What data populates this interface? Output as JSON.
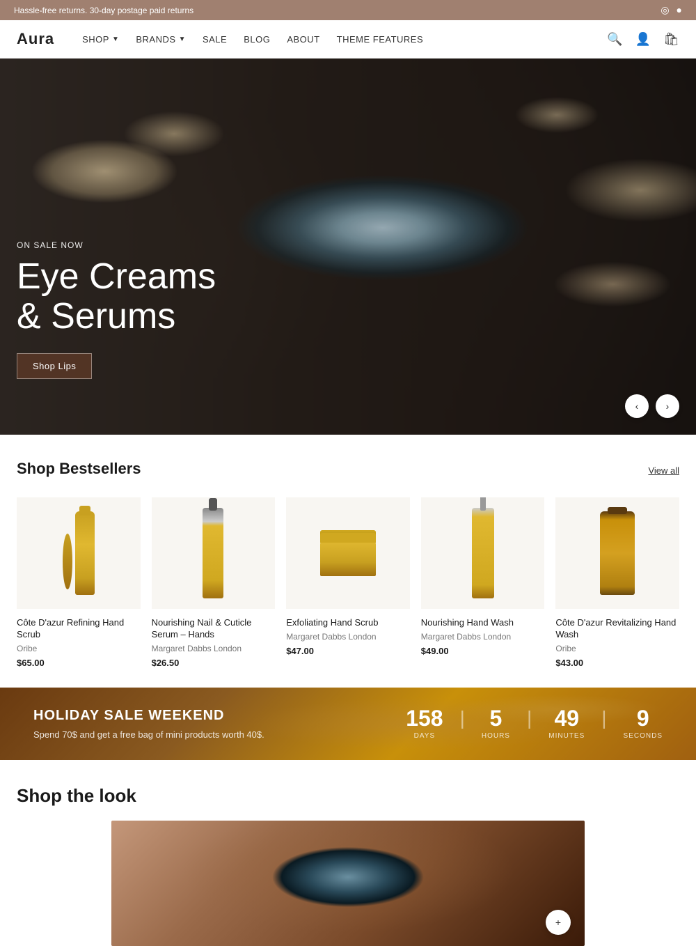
{
  "announcement": {
    "text": "Hassle-free returns. 30-day postage paid returns",
    "social": {
      "instagram": "instagram-icon",
      "facebook": "facebook-icon"
    }
  },
  "header": {
    "logo": "Aura",
    "nav": [
      {
        "label": "SHOP",
        "hasDropdown": true
      },
      {
        "label": "BRANDS",
        "hasDropdown": true
      },
      {
        "label": "SALE",
        "hasDropdown": false
      },
      {
        "label": "BLOG",
        "hasDropdown": false
      },
      {
        "label": "ABOUT",
        "hasDropdown": false
      },
      {
        "label": "THEME FEATURES",
        "hasDropdown": false
      }
    ],
    "icons": {
      "search": "search-icon",
      "account": "account-icon",
      "cart": "cart-icon"
    }
  },
  "hero": {
    "tag": "ON SALE NOW",
    "title_line1": "Eye Creams",
    "title_line2": "& Serums",
    "cta_label": "Shop Lips"
  },
  "bestsellers": {
    "title": "Shop Bestsellers",
    "view_all": "View all",
    "products": [
      {
        "name": "Côte D'azur Refining Hand Scrub",
        "brand": "Oribe",
        "price": "$65.00",
        "type": "tube"
      },
      {
        "name": "Nourishing Nail & Cuticle Serum – Hands",
        "brand": "Margaret Dabbs London",
        "price": "$26.50",
        "type": "bottle"
      },
      {
        "name": "Exfoliating Hand Scrub",
        "brand": "Margaret Dabbs London",
        "price": "$47.00",
        "type": "jar"
      },
      {
        "name": "Nourishing Hand Wash",
        "brand": "Margaret Dabbs London",
        "price": "$49.00",
        "type": "pump"
      },
      {
        "name": "Côte D'azur Revitalizing Hand Wash",
        "brand": "Oribe",
        "price": "$43.00",
        "type": "golden_bottle"
      }
    ]
  },
  "holiday_sale": {
    "title": "HOLIDAY SALE WEEKEND",
    "subtitle": "Spend 70$ and get a free bag of mini products worth 40$.",
    "countdown": {
      "days": "158",
      "hours": "5",
      "minutes": "49",
      "seconds": "9",
      "days_label": "DAYS",
      "hours_label": "HOURS",
      "minutes_label": "MINUTES",
      "seconds_label": "SECONDS"
    }
  },
  "shop_look": {
    "title": "Shop the look"
  }
}
